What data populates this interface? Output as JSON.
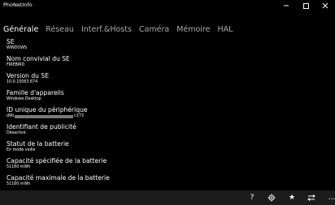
{
  "window": {
    "title": "PhoNetInfo"
  },
  "tabs": [
    {
      "label": "Générale",
      "active": true
    },
    {
      "label": "Réseau"
    },
    {
      "label": "Interf.&Hosts"
    },
    {
      "label": "Caméra"
    },
    {
      "label": "Mémoire"
    },
    {
      "label": "HAL"
    }
  ],
  "items": [
    {
      "label": "SE",
      "value": "WINDOWS"
    },
    {
      "label": "Nom convivial du SE",
      "value": "FIREBIRD"
    },
    {
      "label": "Version du SE",
      "value": "10.0.15063.674"
    },
    {
      "label": "Famille d'appareils",
      "value": "Windows.Desktop"
    },
    {
      "label": "ID unique du périphérique",
      "value_prefix": "d9b",
      "value_suffix": "c173"
    },
    {
      "label": "Identifiant de publicité",
      "value": "Désactivé"
    },
    {
      "label": "Statut de la batterie",
      "value": "En mode veille"
    },
    {
      "label": "Capacité spécifiée de la batterie",
      "value": "51160 mWh"
    },
    {
      "label": "Capacité maximale de la batterie",
      "value": "51160 mWh"
    }
  ],
  "appbar": {
    "help": "?",
    "favorite": "★",
    "more": "..."
  },
  "colors": {
    "background": "#000000",
    "inactive_tab": "#a9a9a9",
    "appbar": "#1c1c1c",
    "masked_bar": "#7a7a7a"
  }
}
